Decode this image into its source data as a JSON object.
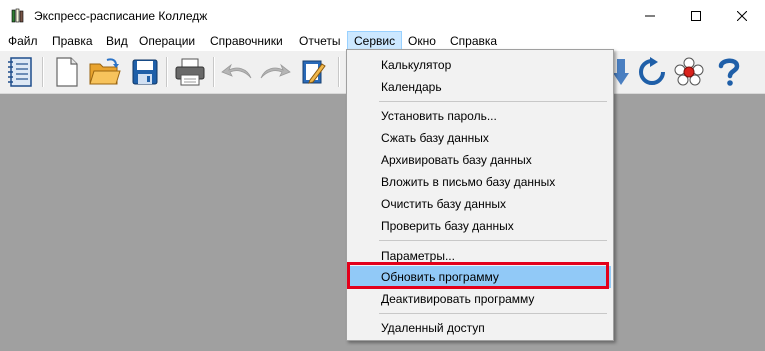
{
  "window": {
    "title": "Экспресс-расписание Колледж",
    "icon": "book-stack-icon"
  },
  "menubar": {
    "items": [
      "Файл",
      "Правка",
      "Вид",
      "Операции",
      "Справочники",
      "Отчеты",
      "Сервис",
      "Окно",
      "Справка"
    ],
    "open_item": "Сервис"
  },
  "toolbar": {
    "buttons": [
      "schedule-list-icon",
      "new-document-icon",
      "open-folder-icon",
      "save-icon",
      "print-icon",
      "undo-icon",
      "redo-icon",
      "edit-icon",
      "sort-icon",
      "refresh-icon",
      "network-icon",
      "help-icon"
    ]
  },
  "service_menu": {
    "items": [
      "Калькулятор",
      "Календарь",
      "Установить пароль...",
      "Сжать базу данных",
      "Архивировать базу данных",
      "Вложить в письмо базу данных",
      "Очистить базу данных",
      "Проверить базу данных",
      "Параметры...",
      "Обновить программу",
      "Деактивировать программу",
      "Удаленный доступ"
    ],
    "highlighted": "Обновить программу"
  },
  "colors": {
    "highlight_frame": "#e3001b",
    "menu_hover": "#91c9f7",
    "workspace": "#a0a0a0"
  }
}
